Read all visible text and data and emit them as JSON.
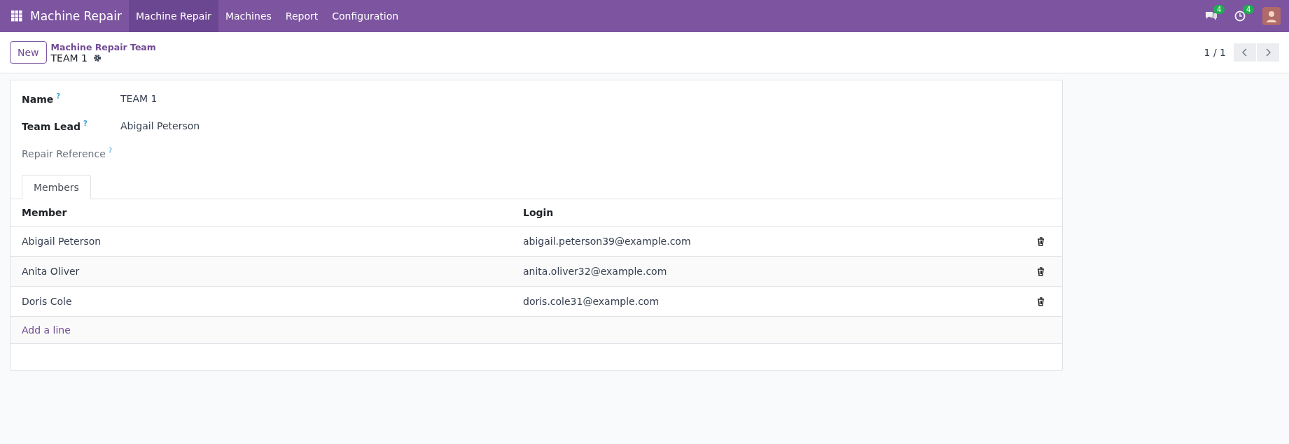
{
  "navbar": {
    "app_name": "Machine Repair",
    "menu": [
      {
        "label": "Machine Repair",
        "selected": true
      },
      {
        "label": "Machines",
        "selected": false
      },
      {
        "label": "Report",
        "selected": false
      },
      {
        "label": "Configuration",
        "selected": false
      }
    ],
    "messages_count": "4",
    "activities_count": "4"
  },
  "control_panel": {
    "new_button": "New",
    "breadcrumb": "Machine Repair Team",
    "record_title": "TEAM 1",
    "pager": "1 / 1"
  },
  "form": {
    "fields": [
      {
        "label": "Name",
        "help": "?",
        "value": "TEAM 1",
        "bold": true
      },
      {
        "label": "Team Lead",
        "help": "?",
        "value": "Abigail Peterson",
        "bold": true
      },
      {
        "label": "Repair Reference",
        "help": "?",
        "bold": false
      }
    ],
    "tabs": [
      {
        "label": "Members",
        "selected": true
      }
    ],
    "table": {
      "columns": [
        "Member",
        "Login"
      ],
      "rows": [
        {
          "member": "Abigail Peterson",
          "login": "abigail.peterson39@example.com"
        },
        {
          "member": "Anita Oliver",
          "login": "anita.oliver32@example.com"
        },
        {
          "member": "Doris Cole",
          "login": "doris.cole31@example.com"
        }
      ],
      "add_line": "Add a line"
    }
  }
}
